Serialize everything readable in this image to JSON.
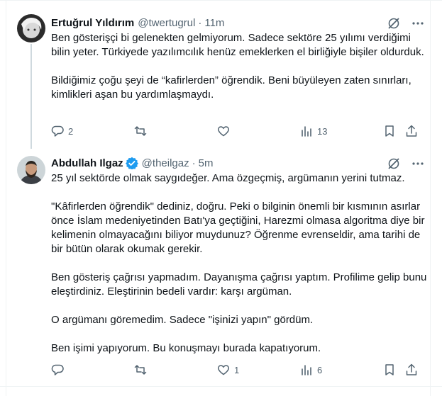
{
  "tweets": [
    {
      "name": "Ertuğrul Yıldırım",
      "handle": "@twertugrul",
      "time": "11m",
      "paragraphs": [
        "Ben gösterişçi bi gelenekten gelmiyorum. Sadece sektöre 25 yılımı verdiğimi bilin yeter. Türkiyede yazılımcılık henüz emeklerken el birliğiyle bişiler oldurduk.",
        "Bildiğimiz çoğu şeyi de “kafirlerden” öğrendik. Beni büyüleyen zaten sınırları, kimlikleri aşan bu yardımlaşmaydı."
      ],
      "replies": "2",
      "reposts": "",
      "likes": "",
      "views": "13"
    },
    {
      "name": "Abdullah Ilgaz",
      "handle": "@theilgaz",
      "time": "5m",
      "verified": true,
      "paragraphs": [
        "25 yıl sektörde olmak saygıdeğer. Ama özgeçmiş, argümanın yerini tutmaz.",
        "\"Kâfirlerden öğrendik\" dediniz, doğru. Peki o bilginin önemli bir kısmının asırlar önce İslam medeniyetinden Batı'ya geçtiğini, Harezmi olmasa algoritma diye bir kelimenin olmayacağını biliyor muydunuz? Öğrenme evrenseldir, ama tarihi de bir bütün olarak okumak gerekir.",
        "Ben gösteriş çağrısı yapmadım. Dayanışma çağrısı yaptım. Profilime gelip bunu eleştirdiniz. Eleştirinin bedeli vardır: karşı argüman.",
        "O argümanı göremedim. Sadece \"işinizi yapın\" gördüm.",
        "Ben işimi yapıyorum. Bu konuşmayı burada kapatıyorum."
      ],
      "replies": "",
      "reposts": "",
      "likes": "1",
      "views": "6"
    }
  ],
  "colors": {
    "text": "#0f1419",
    "secondary": "#536471",
    "verified": "#1d9bf0",
    "border": "#eff3f4"
  }
}
